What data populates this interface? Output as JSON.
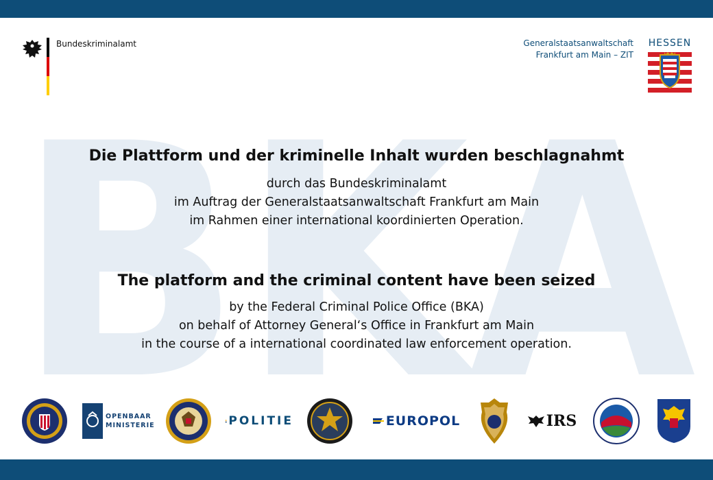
{
  "header": {
    "left_org": "Bundeskriminalamt",
    "right_org_line1": "Generalstaatsanwaltschaft",
    "right_org_line2": "Frankfurt am Main – ZIT",
    "state_name": "HESSEN"
  },
  "watermark": {
    "text": "BKA",
    "color": "#e6edf4"
  },
  "german": {
    "headline": "Die Plattform und der kriminelle Inhalt wurden beschlagnahmt",
    "line1": "durch das Bundeskriminalamt",
    "line2": "im Auftrag der Generalstaatsanwaltschaft Frankfurt am Main",
    "line3": "im Rahmen einer international koordinierten Operation."
  },
  "english": {
    "headline": "The platform and the criminal content have been seized",
    "line1": "by the Federal Criminal Police Office (BKA)",
    "line2": "on behalf of Attorney General‘s Office in Frankfurt am Main",
    "line3": "in the course of a international coordinated law enforcement operation."
  },
  "logos": {
    "openbaar_line1": "OPENBAAR",
    "openbaar_line2": "MINISTERIE",
    "politie": "POLITIE",
    "europol": "EUROPOL",
    "irs": "IRS"
  },
  "colors": {
    "bar": "#0e4d78",
    "accent_blue": "#0e4d78",
    "hessen_red": "#d31f27",
    "flag_black": "#000000",
    "flag_red": "#dd0000",
    "flag_gold": "#ffce00"
  }
}
